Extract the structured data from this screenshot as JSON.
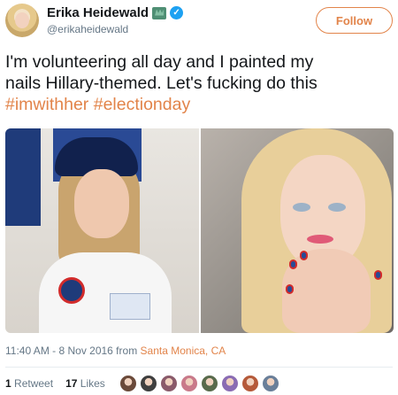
{
  "user": {
    "display_name": "Erika Heidewald",
    "handle": "@erikaheidewald",
    "verified": true,
    "follow_label": "Follow"
  },
  "tweet": {
    "text_line_1": "I'm volunteering all day and I painted my",
    "text_line_2": "nails Hillary-themed. Let's fucking do this",
    "hashtag_1": "#imwithher",
    "hashtag_2": "#electionday"
  },
  "meta": {
    "timestamp": "11:40 AM - 8 Nov 2016 from",
    "location": "Santa Monica, CA"
  },
  "stats": {
    "retweet_count": "1",
    "retweet_label": "Retweet",
    "like_count": "17",
    "like_label": "Likes"
  },
  "likers": [
    {
      "color": "#6b4a3a"
    },
    {
      "color": "#3f3f3f"
    },
    {
      "color": "#8a5a6a"
    },
    {
      "color": "#c97a8a"
    },
    {
      "color": "#596b4c"
    },
    {
      "color": "#8a6cb3"
    },
    {
      "color": "#b55a3a"
    },
    {
      "color": "#6a7f99"
    }
  ],
  "colors": {
    "accent": "#e2844a",
    "verified": "#1da1f2",
    "muted": "#657786"
  }
}
